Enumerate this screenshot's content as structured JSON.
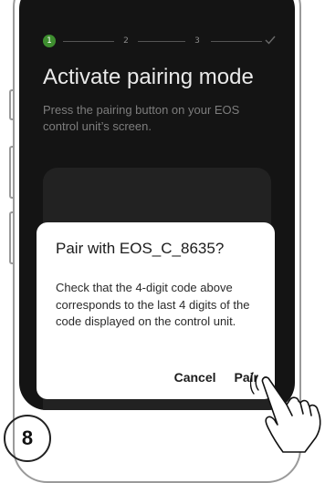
{
  "stepper": {
    "steps": [
      "1",
      "2",
      "3"
    ],
    "active_index": 0,
    "active_color": "#3e8e2f",
    "final_icon": "check-icon"
  },
  "screen": {
    "title": "Activate pairing mode",
    "subtitle": "Press the pairing button on your EOS control unit’s screen."
  },
  "dialog": {
    "title": "Pair with EOS_C_8635?",
    "body": "Check that the 4-digit code above corresponds to the last 4 digits of the code displayed on the control unit.",
    "cancel_label": "Cancel",
    "pair_label": "Pair"
  },
  "hand_icon": "tap-hand-icon",
  "figure": {
    "step_number": "8"
  }
}
